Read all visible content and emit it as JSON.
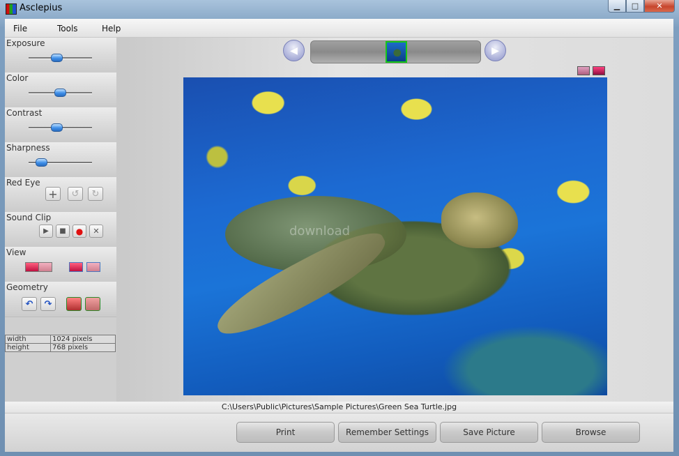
{
  "window": {
    "title": "Asclepius"
  },
  "menu": {
    "items": [
      "File",
      "Tools",
      "Help"
    ]
  },
  "sidebar": {
    "exposure": {
      "label": "Exposure",
      "level_percent": 44
    },
    "color": {
      "label": "Color",
      "level_percent": 49
    },
    "contrast": {
      "label": "Contrast",
      "level_percent": 44
    },
    "sharpness": {
      "label": "Sharpness",
      "level_percent": 20
    },
    "red_eye": {
      "label": "Red Eye"
    },
    "sound_clip": {
      "label": "Sound Clip"
    },
    "view": {
      "label": "View"
    },
    "geometry": {
      "label": "Geometry"
    },
    "info": [
      {
        "key": "width",
        "value": "1024 pixels"
      },
      {
        "key": "height",
        "value": "768 pixels"
      }
    ]
  },
  "main": {
    "file_path": "C:\\Users\\Public\\Pictures\\Sample Pictures\\Green Sea Turtle.jpg",
    "watermark": "download"
  },
  "buttons": {
    "print": "Print",
    "remember_settings": "Remember Settings",
    "save_picture": "Save Picture",
    "browse": "Browse"
  },
  "colors": {
    "slider_thumb": "#3d8ee8",
    "selected_thumb_border": "#18c818",
    "record_button": "#e01010"
  }
}
